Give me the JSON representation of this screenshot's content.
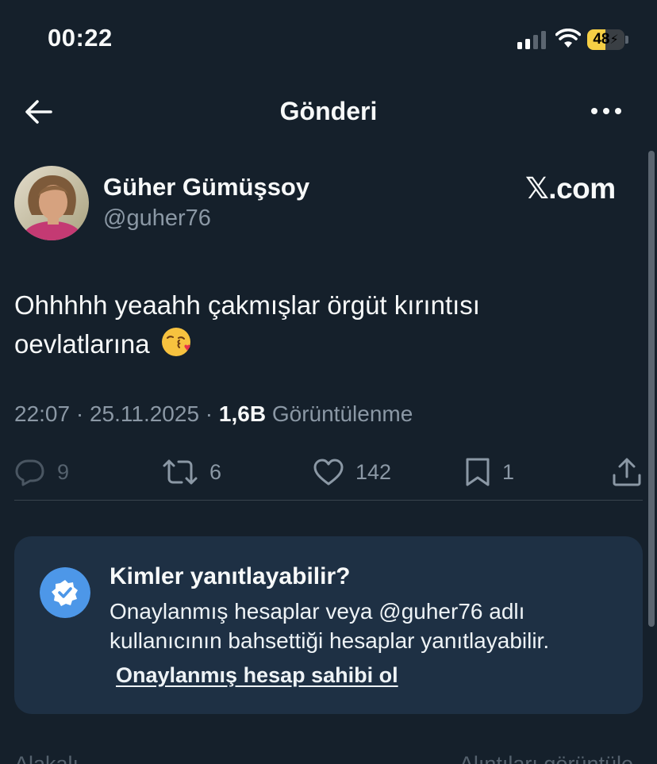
{
  "status_bar": {
    "time": "00:22",
    "battery": "48",
    "battery_level": 0.48,
    "signal_bars": 2,
    "icons": [
      "signal-icon",
      "wifi-icon",
      "battery-charging-icon"
    ]
  },
  "header": {
    "title": "Gönderi",
    "back_icon": "arrow-left-icon",
    "more_icon": "more-horizontal-icon"
  },
  "post": {
    "author_name": "Güher Gümüşsoy",
    "author_handle": "@guher76",
    "watermark": "𝕏.com",
    "text_line1": "Ohhhhh yeaahh çakmışlar örgüt kırıntısı",
    "text_line2": "oevlatlarına",
    "emoji": "face-blowing-kiss-emoji",
    "time": "22:07",
    "separator": " · ",
    "date": "25.11.2025",
    "views_count": "1,6B",
    "views_label": "Görüntülenme"
  },
  "actions": {
    "replies": "9",
    "reposts": "6",
    "likes": "142",
    "bookmarks": "1",
    "icons": [
      "reply-icon",
      "repost-icon",
      "like-icon",
      "bookmark-icon",
      "share-icon"
    ]
  },
  "reply_restriction": {
    "title": "Kimler yanıtlayabilir?",
    "body_line1": "Onaylanmış hesaplar veya @guher76 adlı",
    "body_line2": "kullanıcının bahsettiği hesaplar yanıtlayabilir.",
    "link": "Onaylanmış hesap sahibi ol",
    "icon": "verified-badge-icon"
  },
  "bottom": {
    "left_text": "Alakalı",
    "right_text": "Alıntıları görüntüle"
  },
  "colors": {
    "background": "#15202b",
    "card": "#1e3044",
    "secondary_text": "#8b98a5",
    "accent": "#4d97e8",
    "battery": "#f6cf45"
  }
}
